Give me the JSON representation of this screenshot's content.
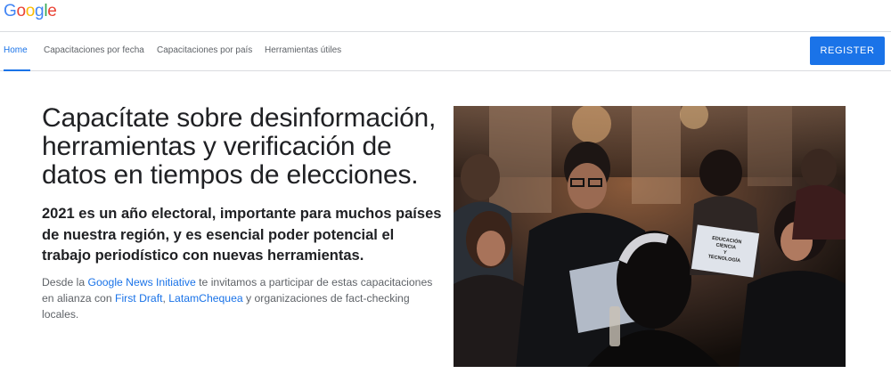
{
  "header": {
    "logo_letters": [
      {
        "char": "G",
        "color": "#4285F4"
      },
      {
        "char": "o",
        "color": "#EA4335"
      },
      {
        "char": "o",
        "color": "#FBBC05"
      },
      {
        "char": "g",
        "color": "#4285F4"
      },
      {
        "char": "l",
        "color": "#34A853"
      },
      {
        "char": "e",
        "color": "#EA4335"
      }
    ]
  },
  "nav": {
    "items": [
      {
        "label": "Home",
        "active": true
      },
      {
        "label": "Capacitaciones por fecha",
        "active": false
      },
      {
        "label": "Capacitaciones por país",
        "active": false
      },
      {
        "label": "Herramientas útiles",
        "active": false
      }
    ],
    "register_label": "REGISTER"
  },
  "hero": {
    "title": "Capacítate sobre desinformación, herramientas y verificación de datos en tiempos de elecciones.",
    "subtitle": "2021 es un año electoral, importante para muchos países de nuestra región, y es esencial poder potencial el trabajo periodístico con nuevas herramientas.",
    "body": {
      "part1": "Desde la ",
      "link1": "Google News Initiative",
      "part2": " te invitamos a participar de estas capacitaciones en alianza con ",
      "link2": "First Draft",
      "sep": ", ",
      "link3": "LatamChequea",
      "part3": " y organizaciones de fact-checking locales."
    },
    "photo_sign": [
      "EDUCACIÓN",
      "CIENCIA",
      "Y",
      "TECNOLOGÍA"
    ]
  },
  "colors": {
    "accent": "#1a73e8",
    "text": "#202124",
    "muted": "#5f6368"
  }
}
